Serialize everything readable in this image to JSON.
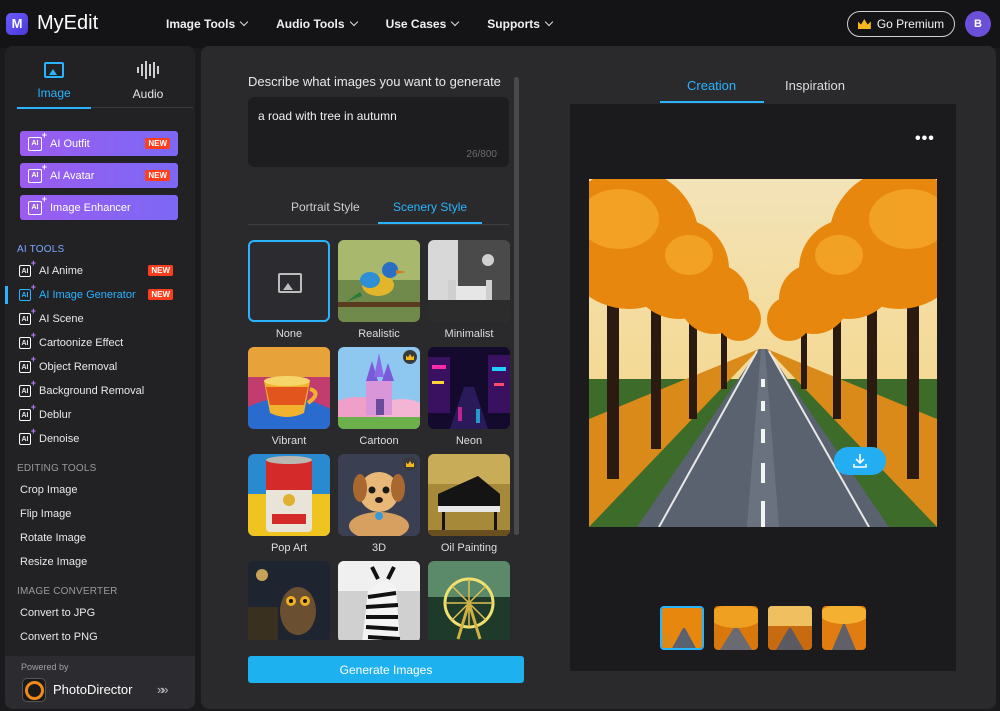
{
  "brand": {
    "name": "MyEdit",
    "logo_letter": "M"
  },
  "nav": [
    {
      "label": "Image Tools"
    },
    {
      "label": "Audio Tools"
    },
    {
      "label": "Use Cases"
    },
    {
      "label": "Supports"
    }
  ],
  "header": {
    "premium_label": "Go Premium",
    "avatar_initial": "B"
  },
  "sidebar": {
    "modes": [
      {
        "label": "Image"
      },
      {
        "label": "Audio"
      }
    ],
    "featured": [
      {
        "label": "AI Outfit",
        "badge": "NEW"
      },
      {
        "label": "AI Avatar",
        "badge": "NEW"
      },
      {
        "label": "Image Enhancer",
        "badge": ""
      }
    ],
    "ai_tools_title": "AI TOOLS",
    "ai_tools": [
      {
        "label": "AI Anime",
        "badge": "NEW"
      },
      {
        "label": "AI Image Generator",
        "badge": "NEW"
      },
      {
        "label": "AI Scene",
        "badge": ""
      },
      {
        "label": "Cartoonize Effect",
        "badge": ""
      },
      {
        "label": "Object Removal",
        "badge": ""
      },
      {
        "label": "Background Removal",
        "badge": ""
      },
      {
        "label": "Deblur",
        "badge": ""
      },
      {
        "label": "Denoise",
        "badge": ""
      }
    ],
    "editing_title": "EDITING TOOLS",
    "editing_tools": [
      "Crop Image",
      "Flip Image",
      "Rotate Image",
      "Resize Image"
    ],
    "converter_title": "IMAGE CONVERTER",
    "converter_tools": [
      "Convert to JPG",
      "Convert to PNG"
    ],
    "powered_by": "Powered by",
    "powered_name": "PhotoDirector",
    "powered_arrow": "»»"
  },
  "prompt": {
    "label": "Describe what images you want to generate",
    "value": "a road with tree in autumn",
    "count": "26/800"
  },
  "style_tabs": [
    {
      "label": "Portrait Style"
    },
    {
      "label": "Scenery Style"
    }
  ],
  "styles": [
    {
      "label": "None"
    },
    {
      "label": "Realistic"
    },
    {
      "label": "Minimalist"
    },
    {
      "label": "Vibrant"
    },
    {
      "label": "Cartoon"
    },
    {
      "label": "Neon"
    },
    {
      "label": "Pop Art"
    },
    {
      "label": "3D"
    },
    {
      "label": "Oil Painting"
    }
  ],
  "generate_label": "Generate Images",
  "view_tabs": [
    {
      "label": "Creation"
    },
    {
      "label": "Inspiration"
    }
  ],
  "more_label": "•••",
  "colors": {
    "accent": "#2ab4ff",
    "badge": "#ff3d1f",
    "feature": "#8f63f2"
  }
}
